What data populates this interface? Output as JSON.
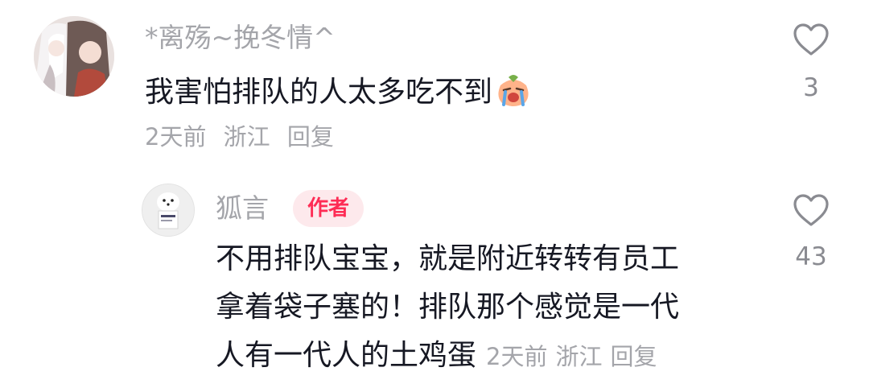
{
  "comment": {
    "username": "*离殇~挽冬情^",
    "text": "我害怕排队的人太多吃不到",
    "emoji": "crying-peach-emoji",
    "time": "2天前",
    "location": "浙江",
    "reply_label": "回复",
    "like_count": "3"
  },
  "reply": {
    "username": "狐言",
    "badge": "作者",
    "lines": [
      "不用排队宝宝，就是附近转转有员工",
      "拿着袋子塞的！排队那个感觉是一代",
      "人有一代人的土鸡蛋"
    ],
    "time": "2天前",
    "location": "浙江",
    "reply_label": "回复",
    "like_count": "43"
  },
  "colors": {
    "text": "#161823",
    "meta": "#a4a5aa",
    "badge_text": "#fe2c55",
    "badge_bg": "#fde9ec",
    "icon": "#8a8b91"
  }
}
